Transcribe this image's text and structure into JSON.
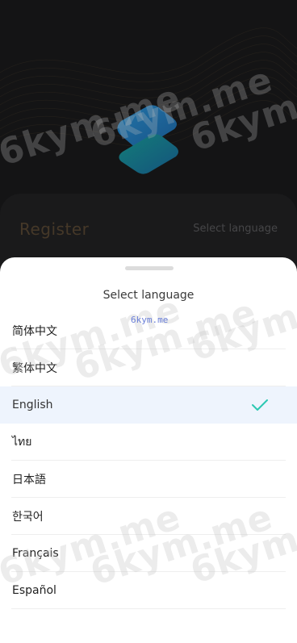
{
  "register": {
    "title": "Register",
    "select_language_label": "Select language"
  },
  "sheet": {
    "title": "Select language",
    "languages": [
      {
        "label": "简体中文",
        "selected": false
      },
      {
        "label": "繁体中文",
        "selected": false
      },
      {
        "label": "English",
        "selected": true
      },
      {
        "label": "ไทย",
        "selected": false
      },
      {
        "label": "日本語",
        "selected": false
      },
      {
        "label": "한국어",
        "selected": false
      },
      {
        "label": "Français",
        "selected": false
      },
      {
        "label": "Español",
        "selected": false
      }
    ]
  },
  "watermark": {
    "text": "6kym.me",
    "small_text": "6kym.me"
  },
  "colors": {
    "accent": "#2cc8b2",
    "selected_bg": "#eef4fd",
    "logo_top": "#2a8fd6",
    "logo_bottom": "#1fb3a6"
  },
  "icons": {
    "check": "check-icon",
    "logo": "app-logo"
  }
}
